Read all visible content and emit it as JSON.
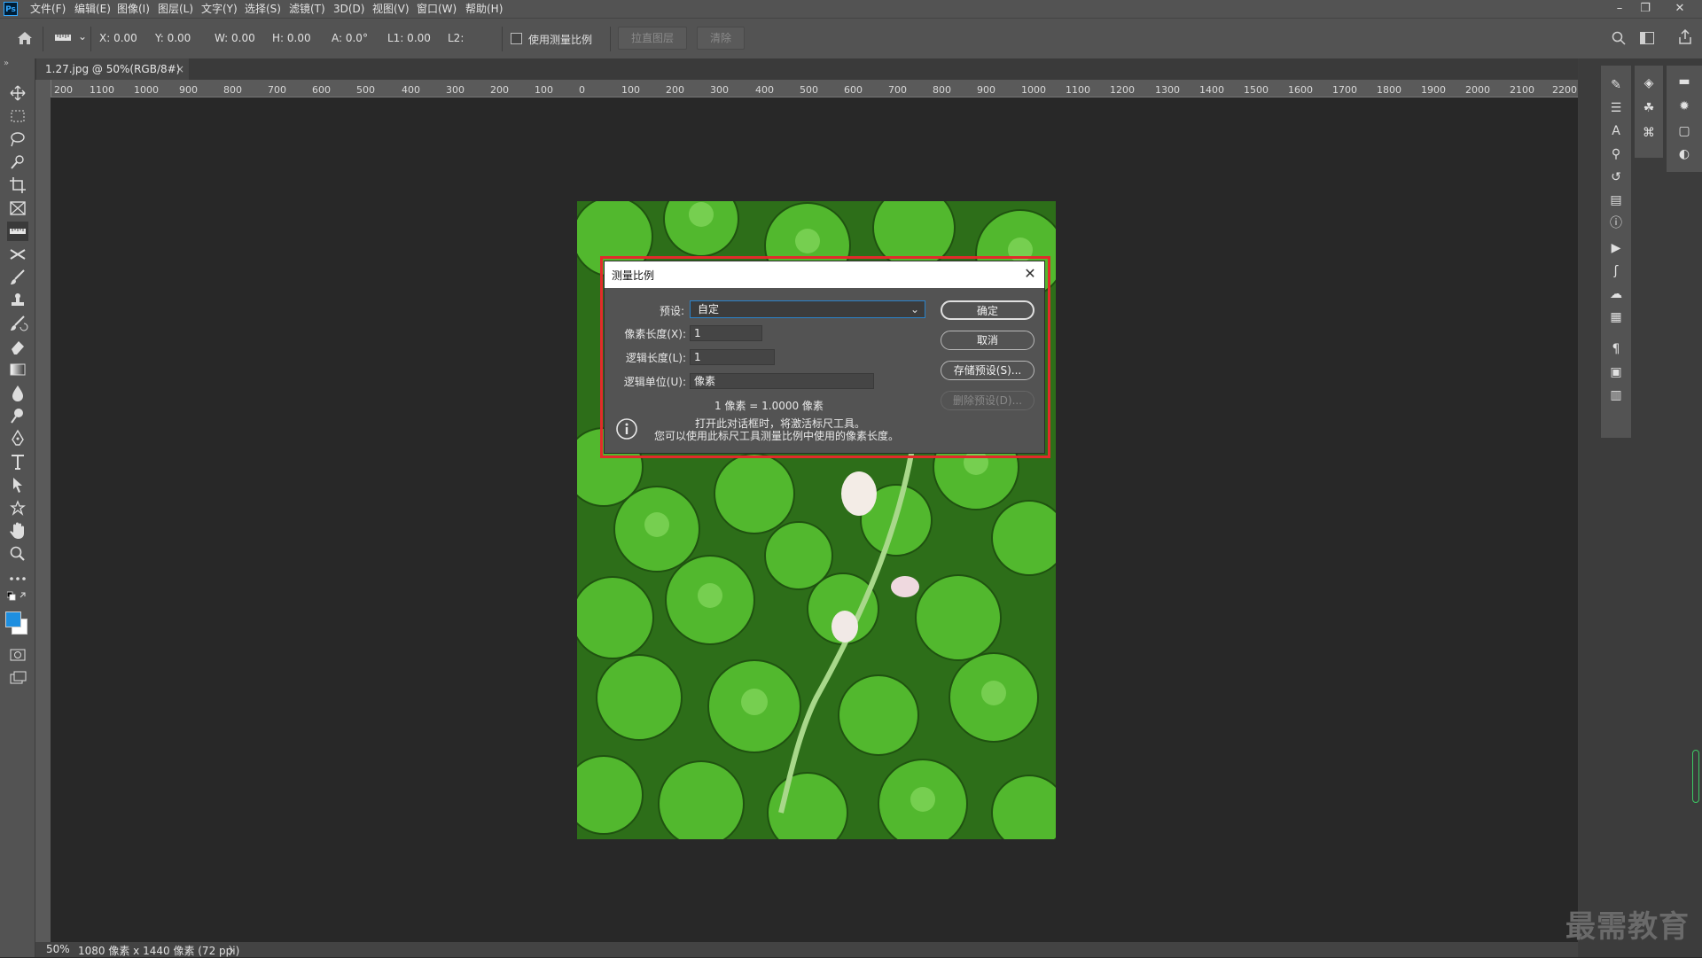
{
  "app": {
    "logo": "Ps",
    "menu": [
      "文件(F)",
      "编辑(E)",
      "图像(I)",
      "图层(L)",
      "文字(Y)",
      "选择(S)",
      "滤镜(T)",
      "3D(D)",
      "视图(V)",
      "窗口(W)",
      "帮助(H)"
    ]
  },
  "options": {
    "x": "X: 0.00",
    "y": "Y: 0.00",
    "w": "W: 0.00",
    "h": "H: 0.00",
    "a": "A: 0.0°",
    "l1": "L1: 0.00",
    "l2": "L2:",
    "use_scale_label": "使用测量比例",
    "straighten_label": "拉直图层",
    "clear_label": "清除"
  },
  "document": {
    "tab_title": "1.27.jpg @ 50%(RGB/8#)",
    "tab_close": "×"
  },
  "ruler": {
    "top_labels": [
      "200",
      "1100",
      "1000",
      "900",
      "800",
      "700",
      "600",
      "500",
      "400",
      "300",
      "200",
      "100",
      "0",
      "100",
      "200",
      "300",
      "400",
      "500",
      "600",
      "700",
      "800",
      "900",
      "1000",
      "1100",
      "1200",
      "1300",
      "1400",
      "1500",
      "1600",
      "1700",
      "1800",
      "1900",
      "2000",
      "2100",
      "2200"
    ]
  },
  "dialog": {
    "title": "测量比例",
    "close": "✕",
    "preset_label": "预设:",
    "preset_value": "自定",
    "pixel_length_label": "像素长度(X):",
    "pixel_length_value": "1",
    "logical_length_label": "逻辑长度(L):",
    "logical_length_value": "1",
    "logical_unit_label": "逻辑单位(U):",
    "logical_unit_value": "像素",
    "ratio_text": "1 像素 = 1.0000 像素",
    "info_line1": "打开此对话框时，将激活标尺工具。",
    "info_line2": "您可以使用此标尺工具测量比例中使用的像素长度。",
    "ok_label": "确定",
    "cancel_label": "取消",
    "save_preset_label": "存储预设(S)...",
    "delete_preset_label": "删除预设(D)..."
  },
  "status": {
    "zoom": "50%",
    "doc_info": "1080 像素 x 1440 像素 (72 ppi)",
    "arrow": "〉"
  },
  "watermark": "最需教育",
  "colors": {
    "accent": "#2a82c9",
    "highlight": "#e22b2b",
    "foreground_swatch": "#1e8fe0",
    "background_swatch": "#ffffff"
  }
}
